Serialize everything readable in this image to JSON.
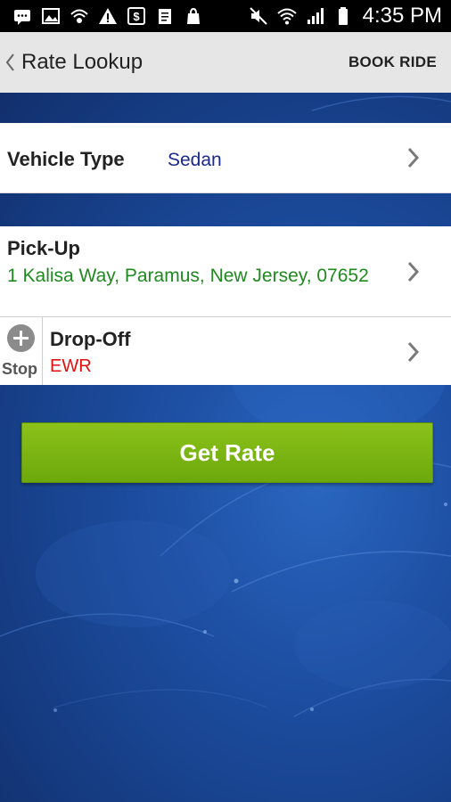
{
  "status_bar": {
    "time": "4:35 PM",
    "left_icons": [
      "message-icon",
      "image-icon",
      "vpn-icon",
      "warning-icon",
      "dollar-icon",
      "clipboard-icon",
      "bag-icon"
    ],
    "right_icons": [
      "mute-icon",
      "wifi-icon",
      "signal-icon",
      "battery-icon"
    ]
  },
  "app_bar": {
    "title": "Rate Lookup",
    "action_label": "BOOK RIDE"
  },
  "vehicle": {
    "label": "Vehicle Type",
    "value": "Sedan"
  },
  "pickup": {
    "label": "Pick-Up",
    "address": "1 Kalisa Way, Paramus, New Jersey, 07652"
  },
  "dropoff": {
    "stop_label": "Stop",
    "label": "Drop-Off",
    "value": "EWR"
  },
  "actions": {
    "get_rate_label": "Get Rate"
  },
  "colors": {
    "pickup_text": "#1f8a1f",
    "dropoff_text": "#e01010",
    "vehicle_value_text": "#1a2a8c",
    "button_green": "#7cb518",
    "background_blue": "#1d4fa3"
  }
}
